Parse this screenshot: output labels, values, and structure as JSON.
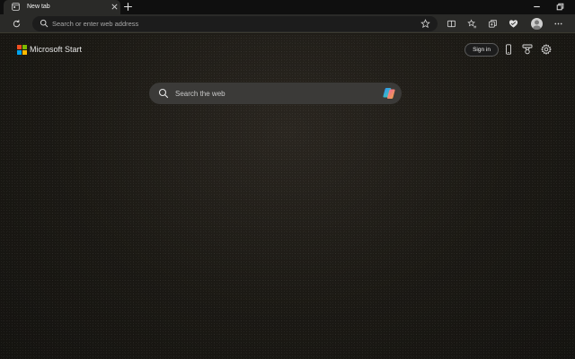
{
  "tab": {
    "title": "New tab",
    "favicon": "new-tab-page-icon"
  },
  "window_controls": [
    "minimize-icon",
    "restore-icon"
  ],
  "toolbar": {
    "address_placeholder": "Search or enter web address",
    "right_icons": [
      "split-screen-icon",
      "favorites-icon",
      "collections-icon",
      "browser-essentials-icon",
      "profile-avatar",
      "more-icon"
    ]
  },
  "page": {
    "brand": "Microsoft Start",
    "signin_label": "Sign in",
    "search_placeholder": "Search the web",
    "top_right_icons": [
      "mobile-phone-icon",
      "rewards-icon",
      "settings-icon"
    ]
  },
  "colors": {
    "ms_red": "#f25022",
    "ms_green": "#7fba00",
    "ms_blue": "#00a4ef",
    "ms_yellow": "#ffb900",
    "page_background": "#1b1914"
  }
}
